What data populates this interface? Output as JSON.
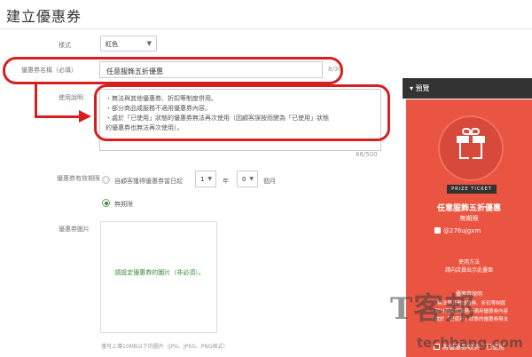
{
  "page": {
    "title": "建立優惠券"
  },
  "form": {
    "style": {
      "label": "樣式",
      "value": "紅色"
    },
    "name": {
      "label": "優惠券名稱（必填）",
      "value": "任意服飾五折優惠",
      "counter": "8/30"
    },
    "description": {
      "label": "使用說明",
      "lines": [
        "・無法與其他優惠券、折扣等制度併用。",
        "・部分商品或服務不適用優惠券內容。",
        "・處於「已使用」狀態的優惠券無法再次使用（因顧客誤按而變為「已使用」狀態",
        "的優惠券也無法再次使用）。"
      ],
      "counter": "86/500"
    },
    "validity": {
      "label": "優惠券有效期限",
      "option_a_text": "自顧客獲得優惠券當日起",
      "months_value": "1",
      "middle_text": "年",
      "months2_value": "0",
      "end_text": "個月",
      "option_b_text": "無期限"
    },
    "image": {
      "label": "優惠券圖片",
      "placeholder": "請設定優惠券的圖片（非必須）。",
      "note": "僅可上傳10MB以下的圖片（JPG、JPEG、PNG格式）"
    }
  },
  "preview": {
    "header": "▾ 預覽",
    "badge": "PRIZE TICKET",
    "coupon_name": "任意服飾五折優惠",
    "validity": "無期限",
    "account": "@276ujgxm",
    "usage_heading": "使用方法",
    "usage_text": "請向店員出示此畫面",
    "desc_heading": "優惠券說明",
    "desc_lines": [
      "・無法與其他優惠券、折扣等制度",
      "・部分商品或服務不適用優惠券內容",
      "・處於「已使用」狀態的優惠券無法"
    ],
    "footer": "將優惠券收到「已使用"
  },
  "watermark": {
    "big": "T客邦",
    "small": "techbang.com"
  },
  "colors": {
    "highlight": "#d62020",
    "card_red": "#ea5541",
    "preview_header": "#333333"
  }
}
